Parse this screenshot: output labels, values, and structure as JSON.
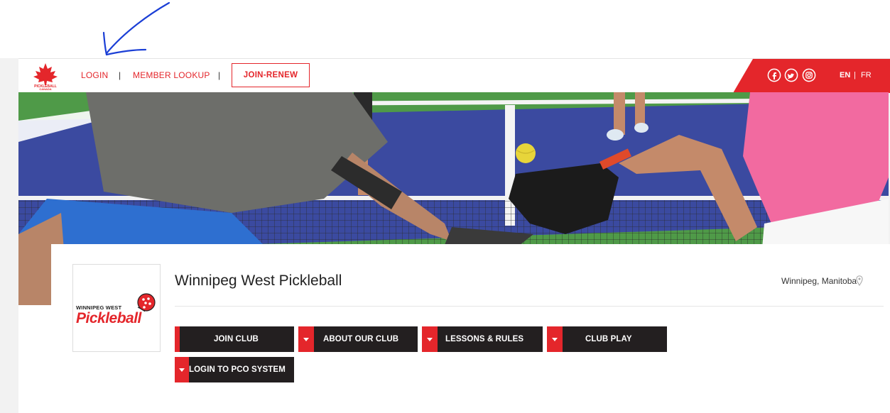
{
  "topbar": {
    "logo_text": "PICKLEBALL CANADA",
    "nav": {
      "login": "LOGIN",
      "sep1": "|",
      "member_lookup": "MEMBER LOOKUP",
      "sep2": "|",
      "join_renew": "JOIN-RENEW"
    },
    "social": [
      "facebook-icon",
      "twitter-icon",
      "instagram-icon"
    ],
    "lang": {
      "en": "EN",
      "sep": "|",
      "fr": "FR"
    }
  },
  "club": {
    "logo": {
      "top": "WINNIPEG WEST",
      "main": "Pickleball"
    },
    "title": "Winnipeg West Pickleball",
    "location": "Winnipeg, Manitoba"
  },
  "buttons": {
    "join_club": "JOIN CLUB",
    "about": "ABOUT OUR CLUB",
    "lessons": "LESSONS & RULES",
    "club_play": "CLUB PLAY",
    "login_pco": "LOGIN TO PCO SYSTEM"
  },
  "colors": {
    "accent": "#e4262b",
    "button_bg": "#231f20",
    "annotation": "#1b3fd6"
  }
}
